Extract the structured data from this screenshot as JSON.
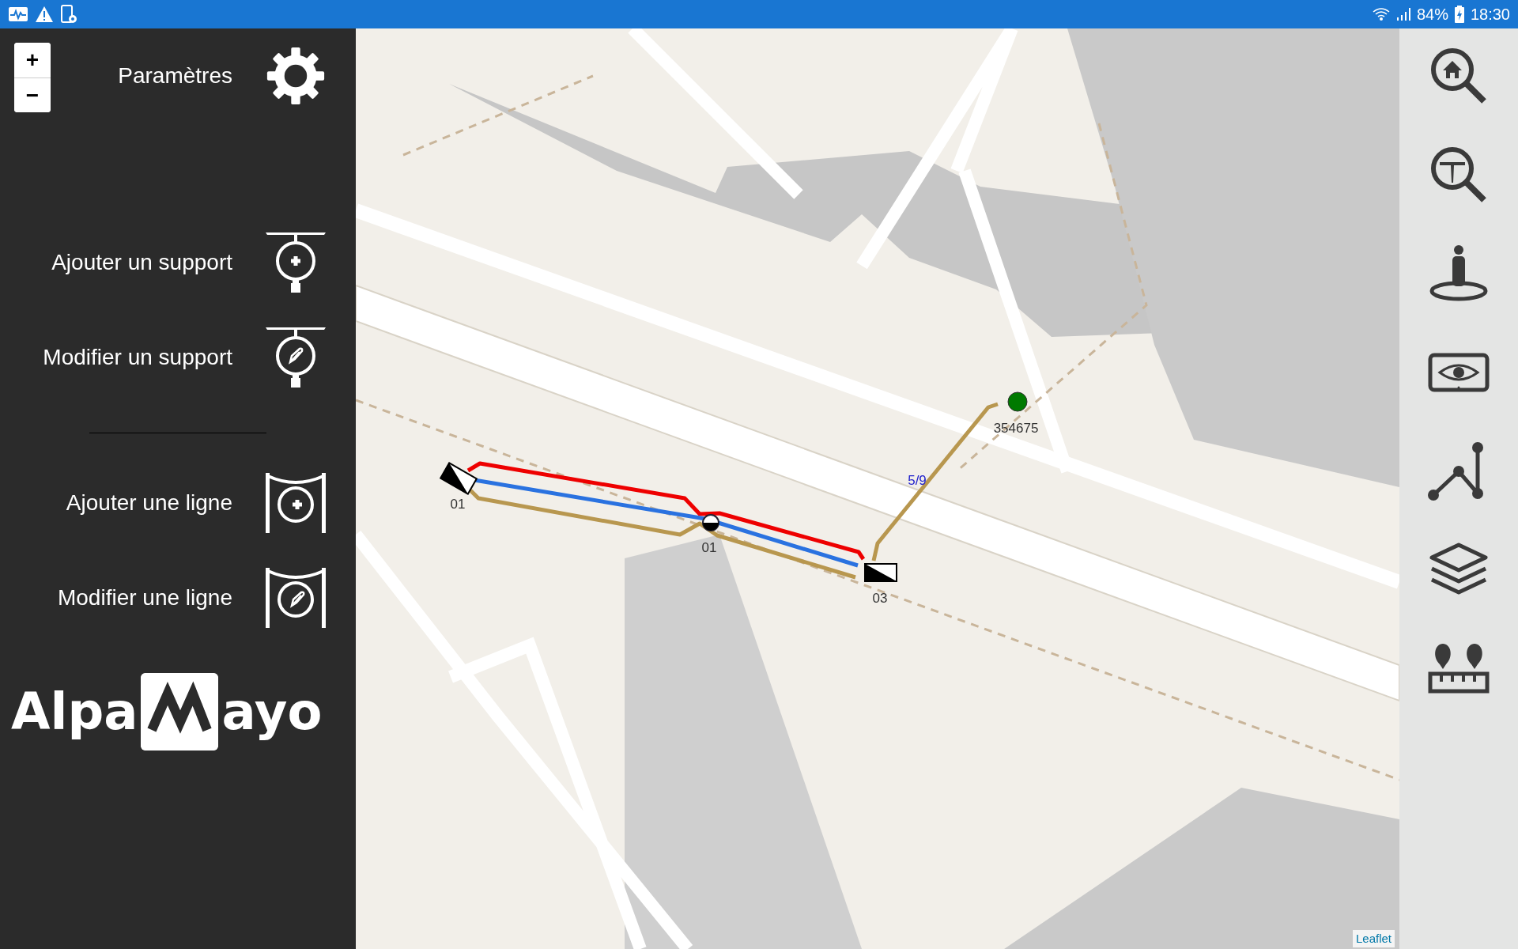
{
  "status_bar": {
    "battery": "84%",
    "time": "18:30"
  },
  "zoom": {
    "in": "+",
    "out": "−"
  },
  "settings": {
    "label": "Paramètres"
  },
  "support_actions": [
    {
      "label": "Ajouter un support",
      "kind": "add"
    },
    {
      "label": "Modifier un support",
      "kind": "edit"
    }
  ],
  "line_actions": [
    {
      "label": "Ajouter une ligne",
      "kind": "add"
    },
    {
      "label": "Modifier une ligne",
      "kind": "edit"
    }
  ],
  "logo": {
    "left": "Alpa",
    "right": "ayo"
  },
  "map": {
    "cables": [
      {
        "color": "#ee0000"
      },
      {
        "color": "#2a72e0"
      },
      {
        "color": "#b8974f"
      }
    ],
    "nodes": [
      {
        "label": "01",
        "kind": "terminal"
      },
      {
        "label": "01",
        "kind": "junction"
      },
      {
        "label": "03",
        "kind": "terminal"
      },
      {
        "label": "354675",
        "kind": "point",
        "color": "#007a00"
      }
    ],
    "span_label": "5/9",
    "attribution": "Leaflet"
  }
}
